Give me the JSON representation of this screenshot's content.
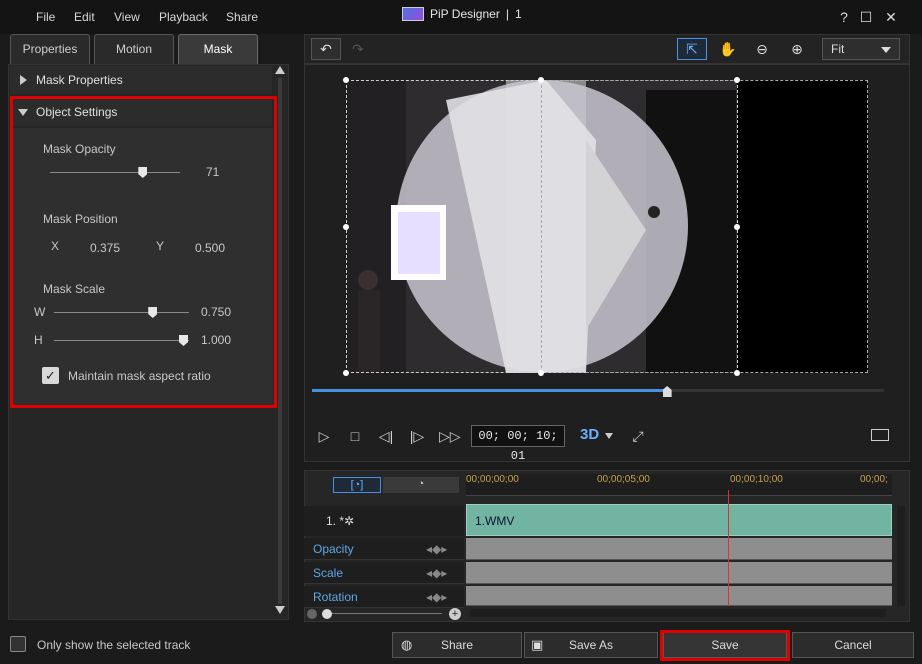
{
  "menu": [
    "File",
    "Edit",
    "View",
    "Playback",
    "Share"
  ],
  "window": {
    "title": "PiP Designer",
    "sep": "|",
    "instance": "1",
    "help": "?",
    "min": "–",
    "max": "☐",
    "close": "✕"
  },
  "tabs": [
    "Properties",
    "Motion",
    "Mask"
  ],
  "mask_properties": {
    "label": "Mask Properties"
  },
  "object_settings": {
    "label": "Object Settings",
    "opacity_label": "Mask Opacity",
    "opacity_value": "71",
    "opacity_level": 71,
    "position_label": "Mask Position",
    "x_label": "X",
    "x_value": "0.375",
    "y_label": "Y",
    "y_value": "0.500",
    "scale_label": "Mask Scale",
    "w_label": "W",
    "w_value": "0.750",
    "w_level": 0.75,
    "h_label": "H",
    "h_value": "1.000",
    "h_level": 1.0,
    "aspect_label": "Maintain mask aspect ratio",
    "aspect_checked": true
  },
  "toolbar": {
    "fit": "Fit"
  },
  "playback": {
    "timecode": "00; 00; 10; 01",
    "mode": "3D",
    "progress": 0.62
  },
  "timeline": {
    "ticks": [
      "00;00;00;00",
      "00;00;05;00",
      "00;00;10;00",
      "00;00;"
    ],
    "track_name": "1. *✲",
    "clip": "1.WMV",
    "rows": [
      "Opacity",
      "Scale",
      "Rotation"
    ]
  },
  "bottom": {
    "only_selected": "Only show the selected track",
    "share": "Share",
    "save_as": "Save As",
    "save": "Save",
    "cancel": "Cancel"
  },
  "colors": {
    "accent": "#4a90e2",
    "highlight": "#e00000",
    "clip": "#72b4a2"
  }
}
